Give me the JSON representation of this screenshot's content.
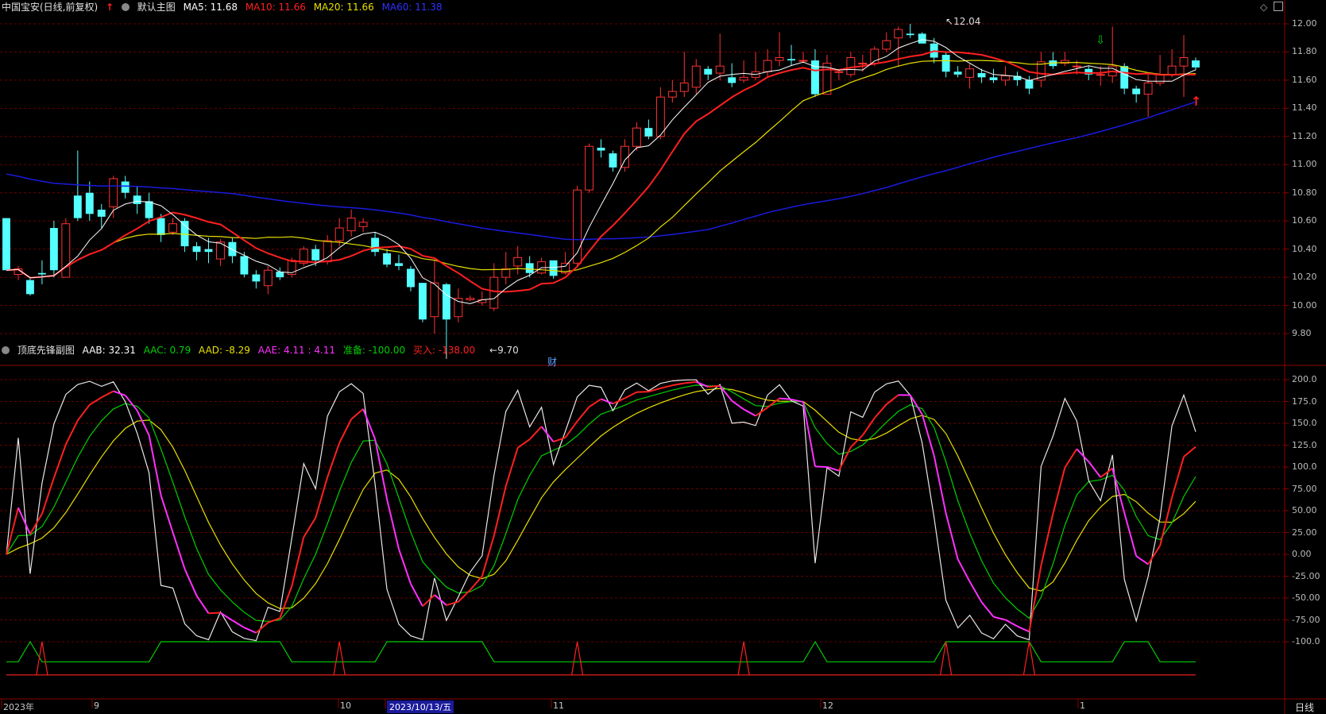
{
  "main_legend": {
    "stock": "中国宝安(日线,前复权)",
    "indicator": "默认主图",
    "ma5": "MA5: 11.68",
    "ma10": "MA10: 11.66",
    "ma20": "MA20: 11.66",
    "ma60": "MA60: 11.38"
  },
  "sub_legend": {
    "indicator": "顶底先锋副图",
    "aab": "AAB: 32.31",
    "aac": "AAC: 0.79",
    "aad": "AAD: -8.29",
    "aae": "AAE: 4.11 : 4.11",
    "prepare": "准备: -100.00",
    "buy": "买入: -138.00"
  },
  "annotations": {
    "high": "12.04",
    "low": "9.70",
    "cai": "财"
  },
  "main_axis_labels": [
    "12.00",
    "11.80",
    "11.60",
    "11.40",
    "11.20",
    "11.00",
    "10.80",
    "10.60",
    "10.40",
    "10.20",
    "10.00",
    "9.80"
  ],
  "sub_axis_labels": [
    "200.0",
    "175.0",
    "150.0",
    "125.0",
    "100.0",
    "75.00",
    "50.00",
    "25.00",
    "0.00",
    "-25.00",
    "-50.00",
    "-75.00",
    "-100.0"
  ],
  "date_labels": [
    "2023年",
    "9",
    "10",
    "2023/10/13/五",
    "11",
    "12",
    "1"
  ],
  "period_label": "日线",
  "colors": {
    "up": "#ff3232",
    "down": "#54ffff",
    "ma5": "#ffffff",
    "ma10": "#ff2020",
    "ma20": "#e8e000",
    "ma60": "#1a1adf",
    "aac": "#00d000",
    "aae_up": "#ff2020",
    "aae_down": "#ff30ff",
    "grid": "#6a0000"
  },
  "chart_data": {
    "type": "candlestick",
    "y_range": [
      9.7,
      12.1
    ],
    "sub_y_range": [
      -140,
      205
    ],
    "candles": [
      [
        10.62,
        10.25,
        10.62,
        10.25
      ],
      [
        10.22,
        10.26,
        10.28,
        10.18
      ],
      [
        10.18,
        10.08,
        10.2,
        10.07
      ],
      [
        10.23,
        10.22,
        10.32,
        10.15
      ],
      [
        10.55,
        10.25,
        10.6,
        10.2
      ],
      [
        10.2,
        10.58,
        10.62,
        10.2
      ],
      [
        10.78,
        10.62,
        11.1,
        10.6
      ],
      [
        10.8,
        10.65,
        10.88,
        10.6
      ],
      [
        10.68,
        10.63,
        10.72,
        10.55
      ],
      [
        10.7,
        10.9,
        10.92,
        10.62
      ],
      [
        10.88,
        10.8,
        10.92,
        10.76
      ],
      [
        10.78,
        10.72,
        10.85,
        10.65
      ],
      [
        10.74,
        10.62,
        10.8,
        10.58
      ],
      [
        10.62,
        10.5,
        10.65,
        10.45
      ],
      [
        10.52,
        10.58,
        10.62,
        10.5
      ],
      [
        10.6,
        10.42,
        10.62,
        10.38
      ],
      [
        10.42,
        10.38,
        10.45,
        10.32
      ],
      [
        10.4,
        10.38,
        10.48,
        10.3
      ],
      [
        10.33,
        10.45,
        10.47,
        10.28
      ],
      [
        10.45,
        10.35,
        10.48,
        10.3
      ],
      [
        10.35,
        10.22,
        10.38,
        10.2
      ],
      [
        10.22,
        10.17,
        10.25,
        10.12
      ],
      [
        10.14,
        10.25,
        10.28,
        10.08
      ],
      [
        10.24,
        10.2,
        10.27,
        10.18
      ],
      [
        10.22,
        10.32,
        10.34,
        10.2
      ],
      [
        10.3,
        10.4,
        10.42,
        10.28
      ],
      [
        10.4,
        10.32,
        10.43,
        10.28
      ],
      [
        10.31,
        10.46,
        10.5,
        10.29
      ],
      [
        10.46,
        10.55,
        10.62,
        10.42
      ],
      [
        10.53,
        10.62,
        10.68,
        10.49
      ],
      [
        10.56,
        10.59,
        10.62,
        10.52
      ],
      [
        10.48,
        10.38,
        10.52,
        10.35
      ],
      [
        10.37,
        10.29,
        10.4,
        10.27
      ],
      [
        10.3,
        10.28,
        10.36,
        10.25
      ],
      [
        10.26,
        10.13,
        10.28,
        10.1
      ],
      [
        10.16,
        9.9,
        10.16,
        9.88
      ],
      [
        9.92,
        10.16,
        10.32,
        9.8
      ],
      [
        10.15,
        9.9,
        10.16,
        9.7
      ],
      [
        9.92,
        10.05,
        10.12,
        9.88
      ],
      [
        10.04,
        10.05,
        10.07,
        10.03
      ],
      [
        10.02,
        10.04,
        10.1,
        10.0
      ],
      [
        9.98,
        10.2,
        10.3,
        9.96
      ],
      [
        10.2,
        10.26,
        10.38,
        10.15
      ],
      [
        10.28,
        10.34,
        10.42,
        10.22
      ],
      [
        10.3,
        10.23,
        10.35,
        10.2
      ],
      [
        10.23,
        10.31,
        10.34,
        10.22
      ],
      [
        10.32,
        10.21,
        10.32,
        10.19
      ],
      [
        10.23,
        10.3,
        10.38,
        10.22
      ],
      [
        10.3,
        10.82,
        10.85,
        10.28
      ],
      [
        10.82,
        11.13,
        11.15,
        10.8
      ],
      [
        11.12,
        11.1,
        11.18,
        11.05
      ],
      [
        11.08,
        10.98,
        11.1,
        10.95
      ],
      [
        10.98,
        11.13,
        11.18,
        10.95
      ],
      [
        11.13,
        11.26,
        11.3,
        11.1
      ],
      [
        11.26,
        11.2,
        11.32,
        11.18
      ],
      [
        11.2,
        11.48,
        11.55,
        11.18
      ],
      [
        11.48,
        11.52,
        11.6,
        11.44
      ],
      [
        11.52,
        11.58,
        11.8,
        11.48
      ],
      [
        11.55,
        11.7,
        11.75,
        11.5
      ],
      [
        11.68,
        11.64,
        11.7,
        11.6
      ],
      [
        11.65,
        11.7,
        11.93,
        11.6
      ],
      [
        11.62,
        11.58,
        11.72,
        11.55
      ],
      [
        11.6,
        11.62,
        11.74,
        11.58
      ],
      [
        11.62,
        11.66,
        11.8,
        11.6
      ],
      [
        11.66,
        11.74,
        11.82,
        11.62
      ],
      [
        11.74,
        11.76,
        11.94,
        11.7
      ],
      [
        11.75,
        11.74,
        11.85,
        11.7
      ],
      [
        11.74,
        11.74,
        11.8,
        11.72
      ],
      [
        11.74,
        11.5,
        11.82,
        11.48
      ],
      [
        11.5,
        11.72,
        11.78,
        11.5
      ],
      [
        11.66,
        11.66,
        11.68,
        11.6
      ],
      [
        11.64,
        11.76,
        11.8,
        11.62
      ],
      [
        11.72,
        11.72,
        11.78,
        11.66
      ],
      [
        11.72,
        11.82,
        11.84,
        11.7
      ],
      [
        11.82,
        11.88,
        11.94,
        11.8
      ],
      [
        11.9,
        11.96,
        11.98,
        11.7
      ],
      [
        11.93,
        11.92,
        12.0,
        11.9
      ],
      [
        11.93,
        11.86,
        11.94,
        11.86
      ],
      [
        11.86,
        11.76,
        11.9,
        11.72
      ],
      [
        11.78,
        11.66,
        11.8,
        11.62
      ],
      [
        11.66,
        11.64,
        11.7,
        11.62
      ],
      [
        11.62,
        11.68,
        11.72,
        11.54
      ],
      [
        11.65,
        11.62,
        11.68,
        11.58
      ],
      [
        11.62,
        11.6,
        11.68,
        11.58
      ],
      [
        11.6,
        11.63,
        11.7,
        11.56
      ],
      [
        11.63,
        11.6,
        11.66,
        11.56
      ],
      [
        11.6,
        11.54,
        11.63,
        11.5
      ],
      [
        11.6,
        11.73,
        11.8,
        11.55
      ],
      [
        11.74,
        11.7,
        11.8,
        11.68
      ],
      [
        11.72,
        11.74,
        11.8,
        11.7
      ],
      [
        11.7,
        11.7,
        11.74,
        11.64
      ],
      [
        11.68,
        11.64,
        11.7,
        11.6
      ],
      [
        11.64,
        11.64,
        11.7,
        11.56
      ],
      [
        11.63,
        11.7,
        11.98,
        11.58
      ],
      [
        11.7,
        11.54,
        11.72,
        11.5
      ],
      [
        11.54,
        11.5,
        11.56,
        11.44
      ],
      [
        11.5,
        11.58,
        11.65,
        11.34
      ],
      [
        11.58,
        11.64,
        11.78,
        11.56
      ],
      [
        11.64,
        11.7,
        11.82,
        11.62
      ],
      [
        11.7,
        11.76,
        11.92,
        11.48
      ],
      [
        11.74,
        11.69,
        11.76,
        11.67
      ]
    ]
  }
}
